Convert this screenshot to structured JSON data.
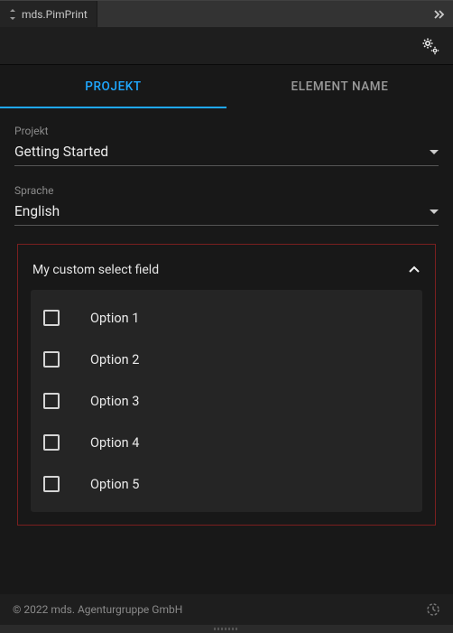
{
  "module": {
    "name": "mds.PimPrint"
  },
  "tabs": [
    {
      "label": "PROJEKT",
      "active": true
    },
    {
      "label": "ELEMENT NAME",
      "active": false
    }
  ],
  "fields": {
    "projekt": {
      "label": "Projekt",
      "value": "Getting Started"
    },
    "sprache": {
      "label": "Sprache",
      "value": "English"
    }
  },
  "custom_select": {
    "title": "My custom select field",
    "options": [
      {
        "label": "Option 1"
      },
      {
        "label": "Option 2"
      },
      {
        "label": "Option 3"
      },
      {
        "label": "Option 4"
      },
      {
        "label": "Option 5"
      }
    ]
  },
  "footer": {
    "copyright": "© 2022 mds. Agenturgruppe GmbH"
  }
}
